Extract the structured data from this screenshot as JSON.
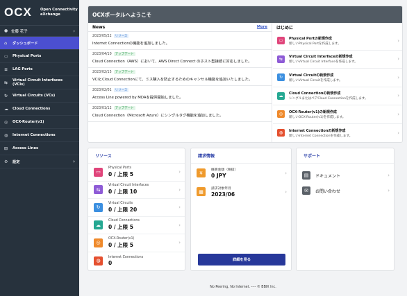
{
  "sidebar": {
    "logo": "OCX",
    "logo_sub_1": "Open Connectivity",
    "logo_sub_2": "eXchange",
    "user": "佐藤 花子",
    "items": [
      {
        "label": "ダッシュボード",
        "icon": "home-icon"
      },
      {
        "label": "Physical Ports",
        "icon": "port-icon"
      },
      {
        "label": "LAG Ports",
        "icon": "lag-icon"
      },
      {
        "label": "Virtual Circuit Interfaces (VCIs)",
        "icon": "vci-icon"
      },
      {
        "label": "Virtual Circuits (VCs)",
        "icon": "vc-icon"
      },
      {
        "label": "Cloud Connections",
        "icon": "cloud-icon"
      },
      {
        "label": "OCX-Router(v1)",
        "icon": "router-icon"
      },
      {
        "label": "Internet Connections",
        "icon": "internet-icon"
      },
      {
        "label": "Access Lines",
        "icon": "access-line-icon"
      },
      {
        "label": "設定",
        "icon": "gear-icon"
      }
    ]
  },
  "welcome": {
    "title": "OCXポータルへようこそ",
    "news_title": "News",
    "more": "More",
    "news": [
      {
        "date": "2023/05/22",
        "tag": "リリース",
        "text": "Internet Connectionの機能を追加しました。"
      },
      {
        "date": "2023/04/10",
        "tag": "アップデート",
        "text": "Cloud Connection（AWS）において、AWS Direct Connect のホスト型接続に対応しました。"
      },
      {
        "date": "2023/02/15",
        "tag": "アップデート",
        "text": "VCIとCloud Connectionにて、ミス購入を防止するためのキャンセル機能を追加いたしました。"
      },
      {
        "date": "2023/02/01",
        "tag": "リリース",
        "text": "Access Line powered by MDAを提供開始しました。"
      },
      {
        "date": "2023/01/12",
        "tag": "アップデート",
        "text": "Cloud Connection（Microsoft Azure）にシングルタグ機能を追加しました。"
      }
    ],
    "start_title": "はじめに",
    "start_items": [
      {
        "title": "Physical Portの新規作成",
        "desc": "新しいPhysical Portを作成します。",
        "color": "#e0457b"
      },
      {
        "title": "Virtual Circuit Interfaceの新規作成",
        "desc": "新しいVirtual Circuit Interfaceを作成します。",
        "color": "#8e5bd6"
      },
      {
        "title": "Virtual Circuitの新規作成",
        "desc": "新しいVirtual Circuitを作成します。",
        "color": "#3b8fe0"
      },
      {
        "title": "Cloud Connectionの新規作成",
        "desc": "シングルまたはペアCloud Connectionを作成します。",
        "color": "#25a892"
      },
      {
        "title": "OCX-Router(v1)の新規作成",
        "desc": "新しいOCX-Router(v1)を作成します。",
        "color": "#ef8a2c"
      },
      {
        "title": "Internet Connectionの新規作成",
        "desc": "新しいInternet Connectionを作成します。",
        "color": "#e5502f"
      }
    ]
  },
  "resources": {
    "title": "リソース",
    "items": [
      {
        "name": "Physical Ports",
        "value": "0 / 上限 5",
        "color": "#e0457b"
      },
      {
        "name": "Virtual Circuit Interfaces",
        "value": "0 / 上限 10",
        "color": "#8e5bd6"
      },
      {
        "name": "Virtual Circuits",
        "value": "0 / 上限 20",
        "color": "#3b8fe0"
      },
      {
        "name": "Cloud Connections",
        "value": "0 / 上限 5",
        "color": "#25a892"
      },
      {
        "name": "OCX-Router(v1)",
        "value": "0 / 上限 5",
        "color": "#ef8a2c"
      },
      {
        "name": "Internet Connections",
        "value": "0",
        "color": "#e5502f"
      }
    ]
  },
  "billing": {
    "title": "請求情報",
    "items": [
      {
        "name": "概算金額（税抜）",
        "value": "0 JPY",
        "color": "#ef9a2c"
      },
      {
        "name": "請求対象年月",
        "value": "2023/06",
        "color": "#ef9a2c"
      }
    ],
    "button": "詳細を見る"
  },
  "support": {
    "title": "サポート",
    "items": [
      {
        "label": "ドキュメント"
      },
      {
        "label": "お問い合わせ"
      }
    ]
  },
  "footer": "No Peering, No Internet. ---- © BBIX Inc."
}
